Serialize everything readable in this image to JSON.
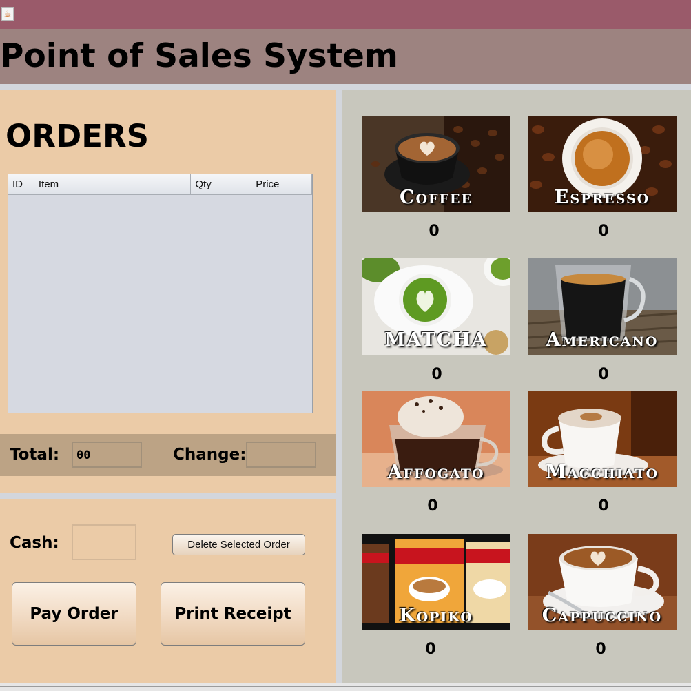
{
  "window": {
    "icon": "java-cup-icon"
  },
  "header": {
    "title": "Point of Sales System"
  },
  "orders": {
    "heading": "ORDERS",
    "columns": [
      "ID",
      "Item",
      "Qty",
      "Price"
    ],
    "rows": []
  },
  "totals": {
    "total_label": "Total:",
    "total_value": "00",
    "change_label": "Change:",
    "change_value": ""
  },
  "payment": {
    "cash_label": "Cash:",
    "cash_value": "",
    "delete_label": "Delete Selected Order",
    "pay_label": "Pay Order",
    "print_label": "Print Receipt"
  },
  "menu": [
    {
      "name": "Coffee",
      "count": "0"
    },
    {
      "name": "Espresso",
      "count": "0"
    },
    {
      "name": "MATCHA",
      "count": "0"
    },
    {
      "name": "Americano",
      "count": "0"
    },
    {
      "name": "Affogato",
      "count": "0"
    },
    {
      "name": "Macchiato",
      "count": "0"
    },
    {
      "name": "Kopiko",
      "count": "0"
    },
    {
      "name": "Cappuccino",
      "count": "0"
    }
  ],
  "colors": {
    "title_bar": "#9a5a6a",
    "header": "#9d8380",
    "panel": "#ebcba7",
    "totals_bar": "#bca385",
    "menu_panel": "#c8c7bd"
  }
}
